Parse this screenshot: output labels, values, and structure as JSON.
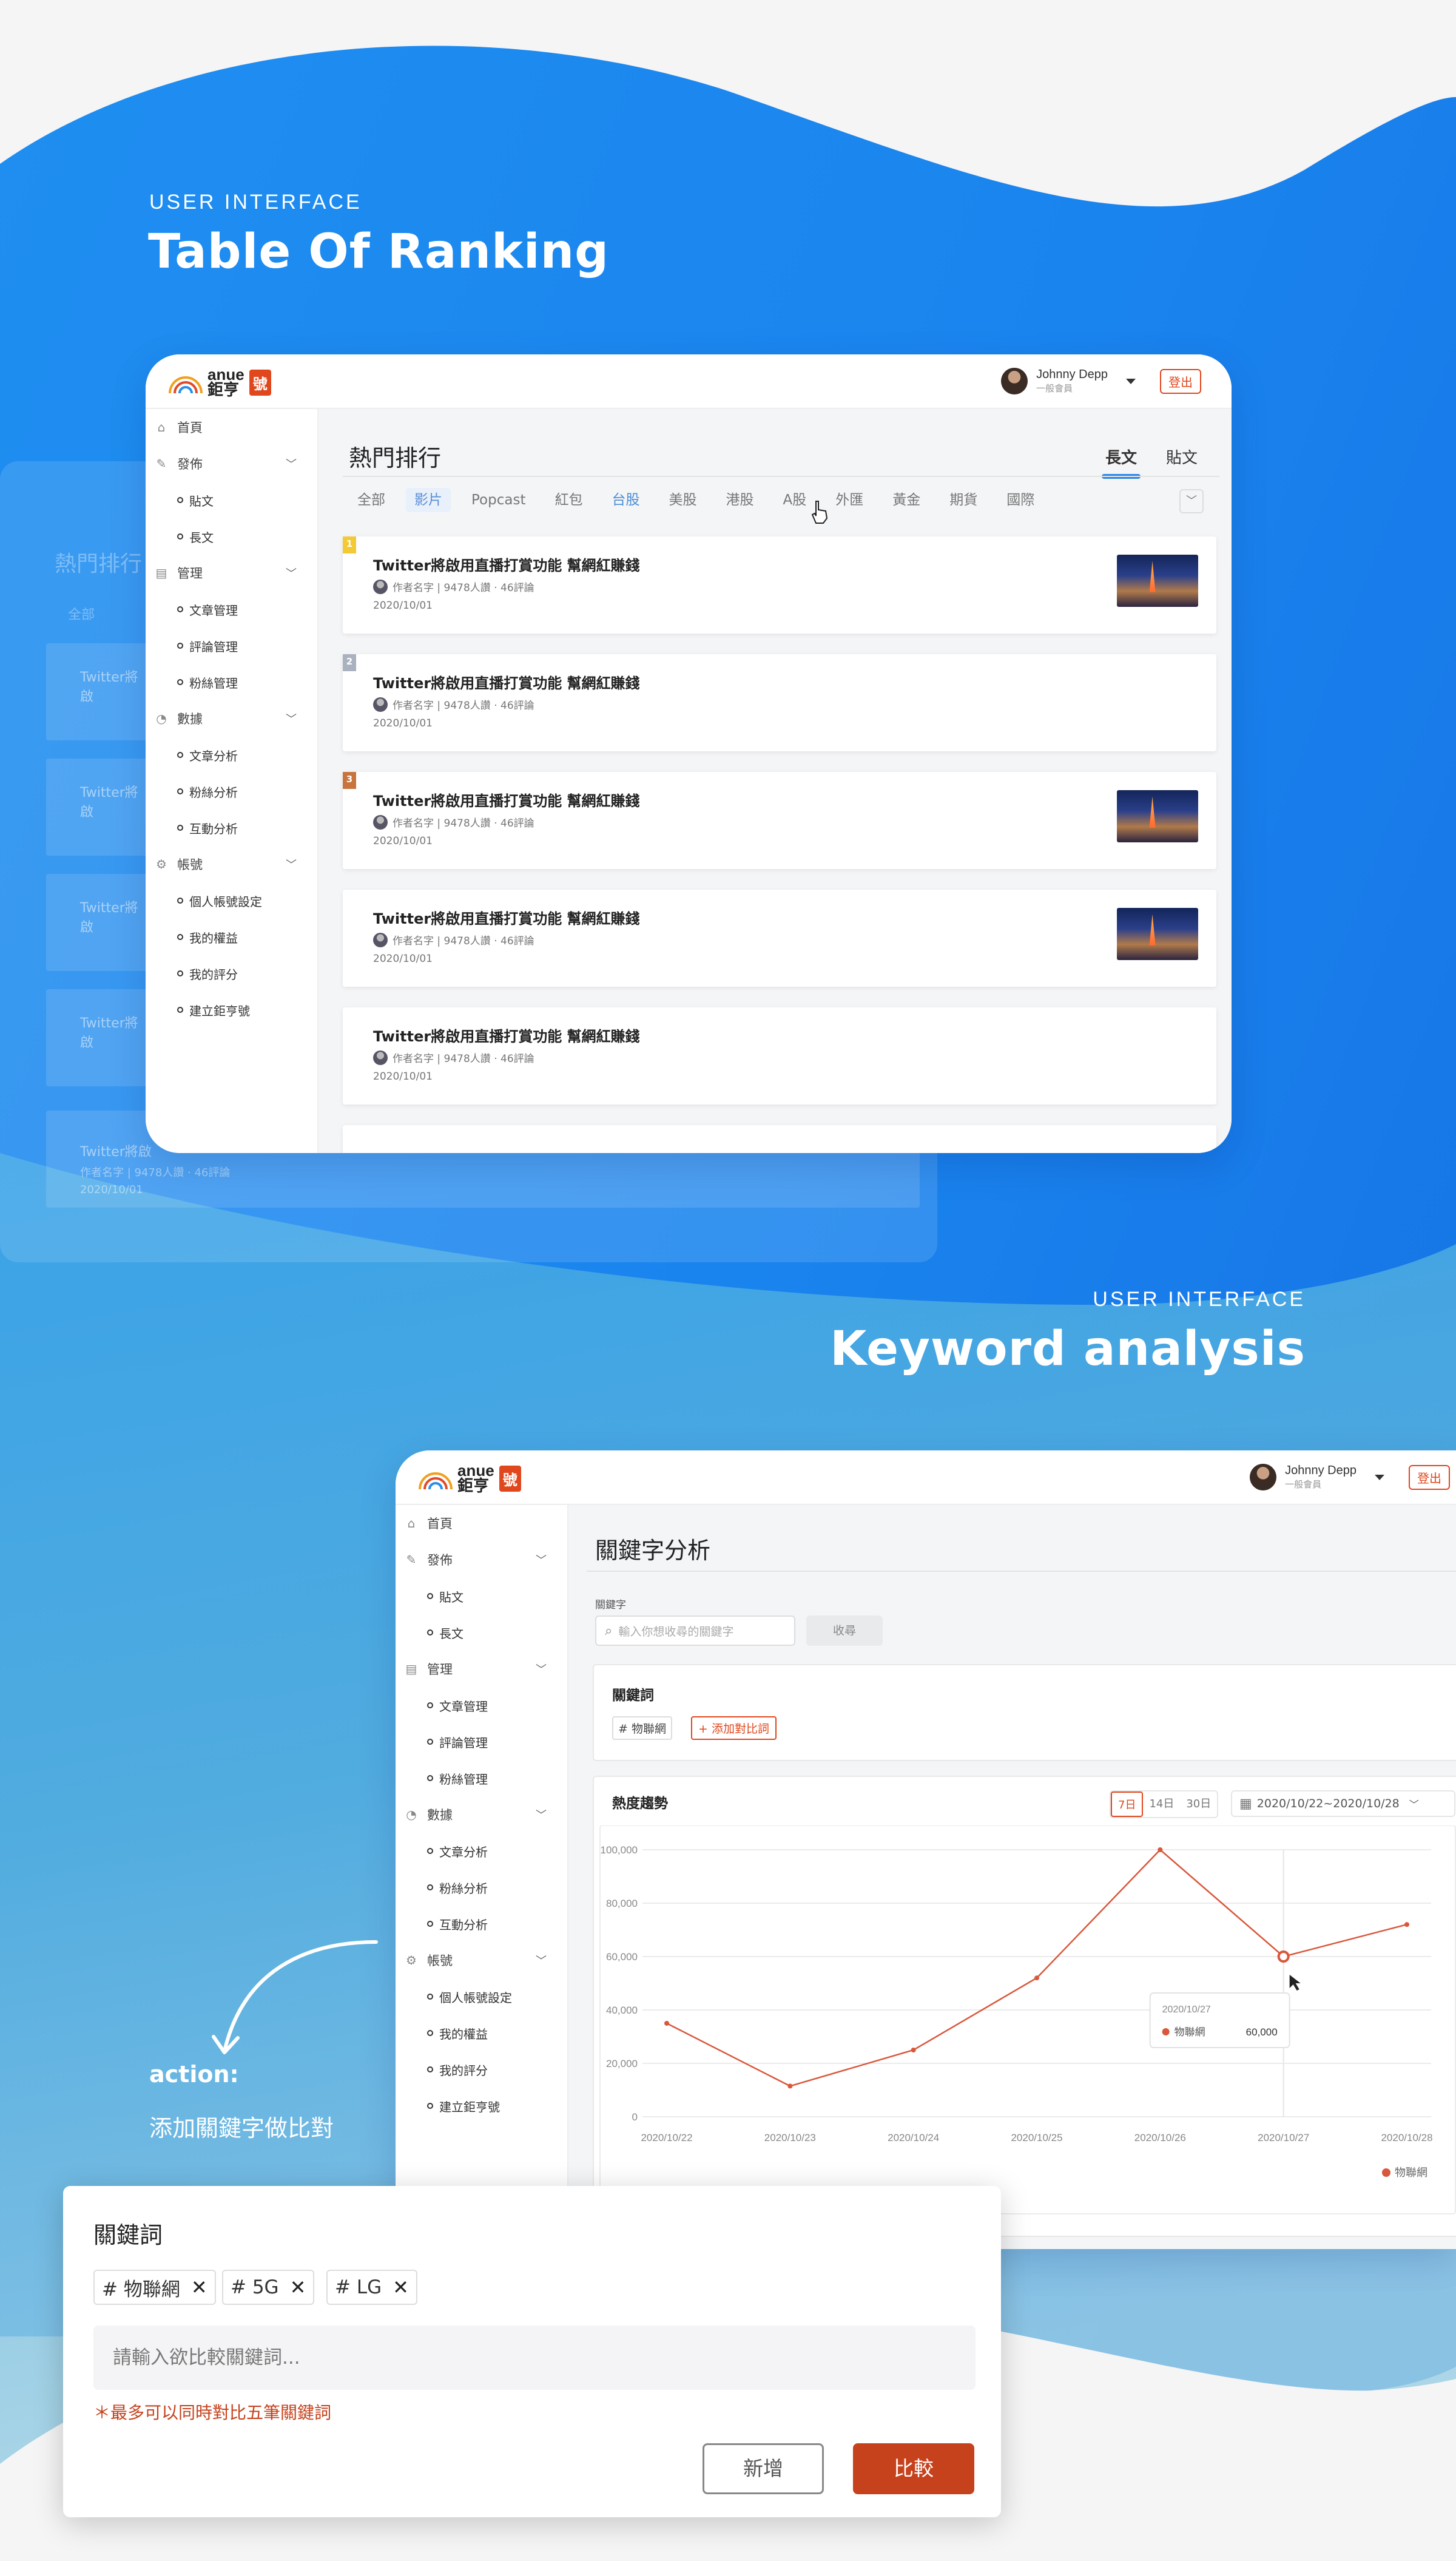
{
  "sections": [
    {
      "eyebrow": "USER INTERFACE",
      "title": "Table Of Ranking"
    },
    {
      "eyebrow": "USER INTERFACE",
      "title": "Keyword analysis"
    }
  ],
  "app": {
    "logo_en": "anue",
    "logo_zh": "鉅亨",
    "logo_badge": "號",
    "user": {
      "name": "Johnny Depp",
      "role": "一般會員"
    },
    "logout": "登出",
    "sidebar": {
      "home": "首頁",
      "publish": "發佈",
      "publish_items": [
        "貼文",
        "長文"
      ],
      "manage": "管理",
      "manage_items": [
        "文章管理",
        "評論管理",
        "粉絲管理"
      ],
      "data": "數據",
      "data_items": [
        "文章分析",
        "粉絲分析",
        "互動分析"
      ],
      "account": "帳號",
      "account_items": [
        "個人帳號設定",
        "我的權益",
        "我的評分",
        "建立鉅亨號"
      ]
    }
  },
  "ranking": {
    "title": "熱門排行",
    "tabs": [
      "長文",
      "貼文"
    ],
    "filters": [
      "全部",
      "影片",
      "Popcast",
      "紅包",
      "台股",
      "美股",
      "港股",
      "A股",
      "外匯",
      "黃金",
      "期貨",
      "國際"
    ],
    "posts": [
      {
        "rank": "1",
        "title": "Twitter將啟用直播打賞功能 幫網紅賺錢",
        "meta": "作者名字 | 9478人讚 · 46評論",
        "date": "2020/10/01"
      },
      {
        "rank": "2",
        "title": "Twitter將啟用直播打賞功能 幫網紅賺錢",
        "meta": "作者名字 | 9478人讚 · 46評論",
        "date": "2020/10/01"
      },
      {
        "rank": "3",
        "title": "Twitter將啟用直播打賞功能 幫網紅賺錢",
        "meta": "作者名字 | 9478人讚 · 46評論",
        "date": "2020/10/01"
      },
      {
        "rank": "",
        "title": "Twitter將啟用直播打賞功能 幫網紅賺錢",
        "meta": "作者名字 | 9478人讚 · 46評論",
        "date": "2020/10/01"
      },
      {
        "rank": "",
        "title": "Twitter將啟用直播打賞功能 幫網紅賺錢",
        "meta": "作者名字 | 9478人讚 · 46評論",
        "date": "2020/10/01"
      }
    ],
    "ghost": {
      "title": "熱門排行",
      "filter": "全部",
      "post_title": "Twitter將啟",
      "meta": "作者名字 | 9478人讚 · 46評論",
      "date": "2020/10/01"
    }
  },
  "keyword": {
    "title": "關鍵字分析",
    "search_label": "關鍵字",
    "search_placeholder": "輸入你想收尋的關鍵字",
    "search_button": "收尋",
    "keywords_title": "關鍵詞",
    "keyword_chip": "# 物聯網",
    "add_compare": "+ 添加對比詞",
    "trend_title": "熱度趨勢",
    "ranges": [
      "7日",
      "14日",
      "30日"
    ],
    "date_range": "2020/10/22~2020/10/28",
    "tooltip": {
      "date": "2020/10/27",
      "series": "物聯網",
      "value": "60,000"
    }
  },
  "action": {
    "label": "action:",
    "desc": "添加關鍵字做比對"
  },
  "modal": {
    "title": "關鍵詞",
    "tags": [
      "# 物聯網",
      "# 5G",
      "# LG"
    ],
    "placeholder": "請輸入欲比較關鍵詞...",
    "note": "＊最多可以同時對比五筆關鍵詞",
    "add": "新增",
    "compare": "比較"
  },
  "colors": {
    "accent": "#e0471d",
    "blue": "#1e88ee",
    "line": "#d9573b"
  },
  "chart_data": {
    "type": "line",
    "title": "熱度趨勢",
    "x": [
      "2020/10/22",
      "2020/10/23",
      "2020/10/24",
      "2020/10/25",
      "2020/10/26",
      "2020/10/27",
      "2020/10/28"
    ],
    "series": [
      {
        "name": "物聯網",
        "values": [
          35000,
          11500,
          25000,
          52000,
          100000,
          60000,
          72000
        ]
      }
    ],
    "yticks": [
      "100,000",
      "80,000",
      "60,000",
      "40,000",
      "20,000",
      "0"
    ],
    "ylim": [
      0,
      100000
    ],
    "legend": "bottom-right",
    "grid": true
  }
}
